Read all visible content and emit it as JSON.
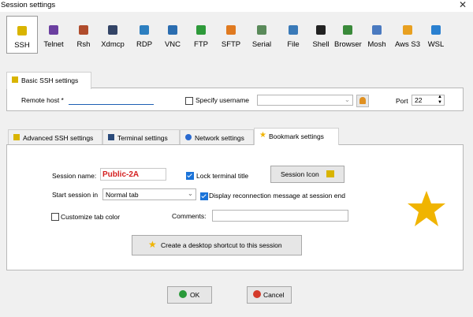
{
  "window": {
    "title": "Session settings",
    "close_glyph": "✕"
  },
  "protocols": [
    {
      "label": "SSH",
      "color": "#d9b400"
    },
    {
      "label": "Telnet",
      "color": "#6b3fa0"
    },
    {
      "label": "Rsh",
      "color": "#b04c2c"
    },
    {
      "label": "Xdmcp",
      "color": "#334466"
    },
    {
      "label": "RDP",
      "color": "#2d7fc0"
    },
    {
      "label": "VNC",
      "color": "#2b6db0"
    },
    {
      "label": "FTP",
      "color": "#2e9a3a"
    },
    {
      "label": "SFTP",
      "color": "#e07a20"
    },
    {
      "label": "Serial",
      "color": "#5a8a5a"
    },
    {
      "label": "File",
      "color": "#3a7ab8"
    },
    {
      "label": "Shell",
      "color": "#222222"
    },
    {
      "label": "Browser",
      "color": "#3a8a3a"
    },
    {
      "label": "Mosh",
      "color": "#4a7ac0"
    },
    {
      "label": "Aws S3",
      "color": "#e8a020"
    },
    {
      "label": "WSL",
      "color": "#2a80d0"
    }
  ],
  "basic": {
    "tab_label": "Basic SSH settings",
    "remote_host_label": "Remote host *",
    "remote_host_value": "",
    "specify_username_label": "Specify username",
    "username_value": "",
    "port_label": "Port",
    "port_value": "22"
  },
  "tabs": [
    {
      "label": "Advanced SSH settings",
      "icon": "wrench-icon"
    },
    {
      "label": "Terminal settings",
      "icon": "terminal-icon"
    },
    {
      "label": "Network settings",
      "icon": "network-icon"
    },
    {
      "label": "Bookmark settings",
      "icon": "star-icon"
    }
  ],
  "bookmark": {
    "session_name_label": "Session name:",
    "session_name_value": "Public-2A",
    "lock_terminal_label": "Lock terminal title",
    "session_icon_label": "Session Icon",
    "start_session_label": "Start session in",
    "start_session_value": "Normal tab",
    "reconnect_label": "Display reconnection message at session end",
    "customize_tab_label": "Customize tab color",
    "comments_label": "Comments:",
    "comments_value": "",
    "shortcut_label": "Create a desktop shortcut to this session",
    "star_color": "#f0b400"
  },
  "buttons": {
    "ok_label": "OK",
    "cancel_label": "Cancel"
  }
}
